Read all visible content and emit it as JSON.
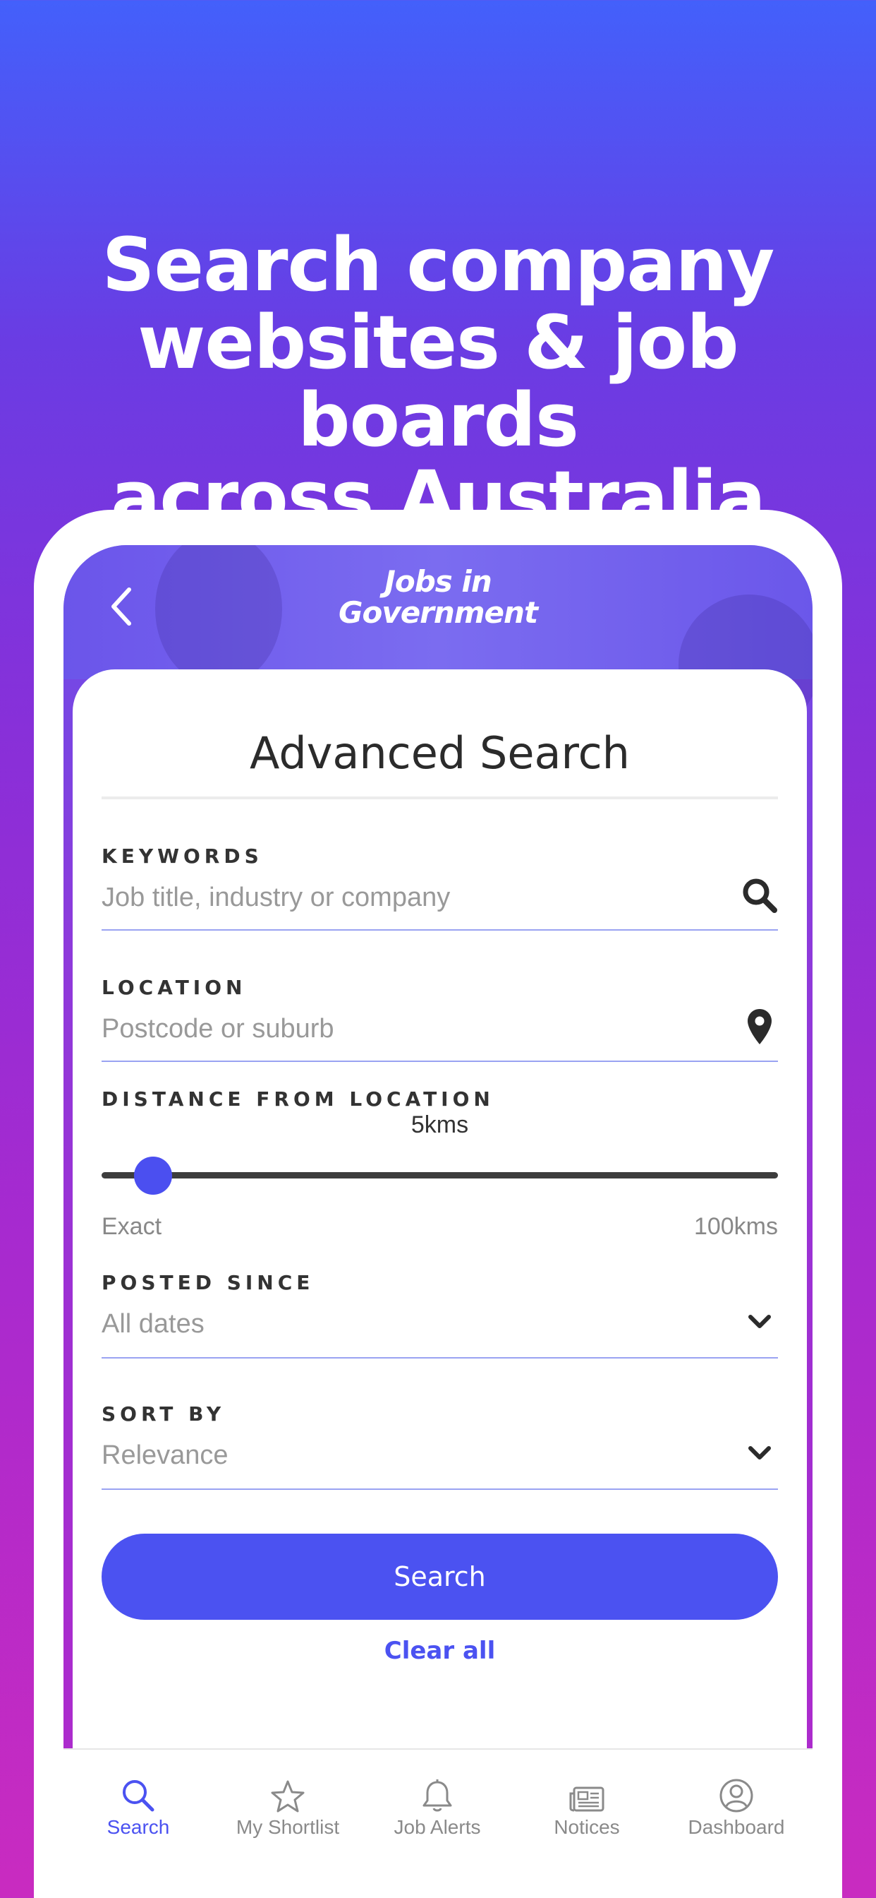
{
  "headline": {
    "lines": [
      "Search company",
      "websites & job boards",
      "across Australia"
    ]
  },
  "app": {
    "logo_line1": "Jobs in",
    "logo_line2": "Government"
  },
  "advanced_search": {
    "title": "Advanced Search",
    "keywords": {
      "label": "KEYWORDS",
      "placeholder": "Job title, industry or company",
      "value": "",
      "icon": "search-icon"
    },
    "location": {
      "label": "LOCATION",
      "placeholder": "Postcode or suburb",
      "value": "",
      "icon": "location-pin-icon"
    },
    "distance": {
      "label": "DISTANCE FROM LOCATION",
      "value_text": "5kms",
      "value": 5,
      "min_label": "Exact",
      "max_label": "100kms",
      "min": 0,
      "max": 100
    },
    "posted_since": {
      "label": "POSTED SINCE",
      "selected": "All dates"
    },
    "sort_by": {
      "label": "SORT BY",
      "selected": "Relevance"
    },
    "search_button": "Search",
    "clear_link": "Clear all"
  },
  "tabbar": {
    "items": [
      {
        "label": "Search",
        "icon": "search-icon",
        "active": true
      },
      {
        "label": "My Shortlist",
        "icon": "star-icon",
        "active": false
      },
      {
        "label": "Job Alerts",
        "icon": "bell-icon",
        "active": false
      },
      {
        "label": "Notices",
        "icon": "newspaper-icon",
        "active": false
      },
      {
        "label": "Dashboard",
        "icon": "user-circle-icon",
        "active": false
      }
    ]
  },
  "colors": {
    "accent": "#4b52f1",
    "background_top": "#4360fb",
    "background_bottom": "#c92bc0"
  }
}
